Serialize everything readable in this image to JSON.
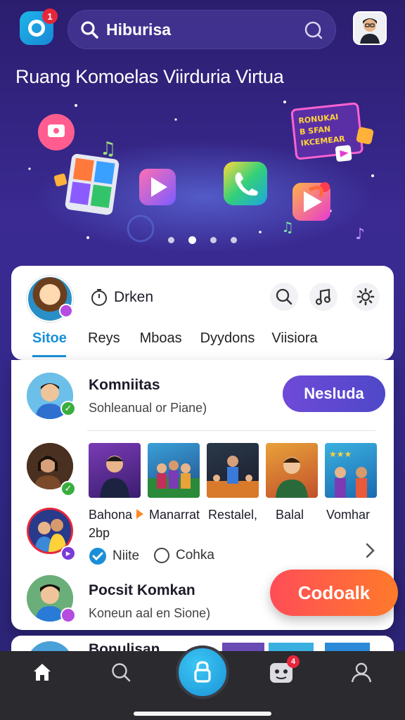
{
  "header": {
    "logo_badge": "1",
    "search_text": "Hiburisa"
  },
  "hero": {
    "title": "Ruang Komoelas Viirduria Virtua",
    "sign_lines": [
      "RONUKAI",
      "B SFAN",
      "IKCEMEAR"
    ]
  },
  "community": {
    "name": "Drken",
    "tabs": [
      {
        "label": "Sitoe",
        "active": true
      },
      {
        "label": "Reys",
        "active": false
      },
      {
        "label": "Mboas",
        "active": false
      },
      {
        "label": "Dyydons",
        "active": false
      },
      {
        "label": "Viisiora",
        "active": false
      }
    ]
  },
  "feed": {
    "row1": {
      "title": "Komniitas",
      "subtitle": "Sohleanual or Piane)",
      "button": "Nesluda"
    },
    "row2": {
      "labels": [
        "Bahona",
        "Manarrat",
        "Restalel,",
        "Balal",
        "Vomhar"
      ],
      "meta": "2bp",
      "choices": [
        "Niite",
        "Cohka"
      ]
    },
    "row3": {
      "title": "Pocsit Komkan",
      "subtitle": "Koneun aal en Sione)",
      "button": "Codoalk"
    },
    "peek_title": "Bonulisan"
  },
  "nav": {
    "notification_badge": "4"
  },
  "colors": {
    "accent_blue": "#1a8fd8",
    "join_purple": "#5b48cf",
    "follow_red": "#ff4d58",
    "check_green": "#3aae3c"
  }
}
